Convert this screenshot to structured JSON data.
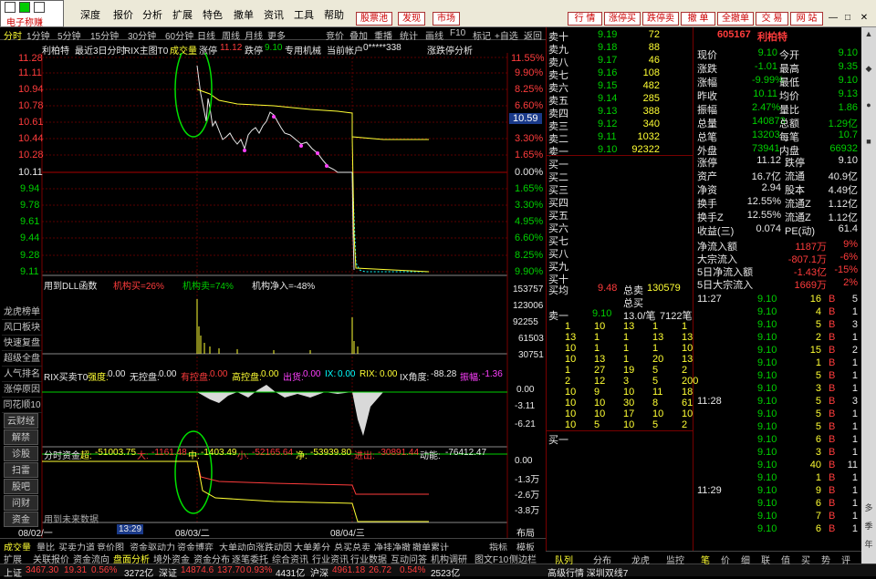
{
  "menu": {
    "logo_label": "电子称赚",
    "items": [
      "",
      "深度",
      "报价",
      "分析",
      "扩展",
      "特色",
      "撒单",
      "资讯",
      "工具",
      "帮助"
    ],
    "pills": [
      "股票池",
      "发现",
      "市场"
    ],
    "right_tabs": [
      "行 情",
      "涨停买",
      "跌停卖",
      "撤 单",
      "全撤单",
      "交 易",
      "网 站"
    ]
  },
  "toolbar": {
    "items": [
      "分时",
      "1分钟",
      "5分钟",
      "15分钟",
      "30分钟",
      "60分钟",
      "日线",
      "周线",
      "月线",
      "更多",
      "竞价",
      "叠加",
      "重播",
      "统计",
      "画线",
      "F10",
      "标记",
      "+自选",
      "返回"
    ]
  },
  "chart_header": {
    "name": "利柏特",
    "title": "最近3日分时",
    "indicator": "RIX主图T0",
    "mode": "成交量",
    "zt_label": "涨停",
    "zt": "11.12",
    "dt_label": "跌停",
    "dt": "9.10",
    "org": "专用机械",
    "account": "当前帐户",
    "account_id": "0*****338",
    "right": "涨跌停分析"
  },
  "price_axis": {
    "left": [
      "11.28",
      "11.11",
      "10.94",
      "10.78",
      "10.61",
      "10.44",
      "10.28",
      "10.11",
      "9.94",
      "9.78",
      "9.61",
      "9.44",
      "9.28",
      "9.11"
    ],
    "right": [
      "11.55%",
      "9.90%",
      "8.25%",
      "6.60%",
      "4.95%",
      "3.30%",
      "1.65%",
      "0.00%",
      "1.65%",
      "3.30%",
      "4.95%",
      "6.60%",
      "8.25%",
      "9.90%"
    ],
    "current": "10.59"
  },
  "vol_panel": {
    "title": "用到DLL函数",
    "buy": "机构买=26%",
    "sell": "机构卖=74%",
    "net": "机构净入=-48%",
    "axis": [
      "153757",
      "123006",
      "92255",
      "61503",
      "30751"
    ]
  },
  "rix_panel": {
    "title": "RIX买卖T0",
    "items": [
      {
        "k": "强度:",
        "v": "0.00"
      },
      {
        "k": "无控盘:",
        "v": "0.00"
      },
      {
        "k": "有控盘:",
        "v": "0.00"
      },
      {
        "k": "高控盘:",
        "v": "0.00"
      },
      {
        "k": "出货:",
        "v": "0.00"
      },
      {
        "k": "IX:",
        "v": "0.00"
      },
      {
        "k": "RIX:",
        "v": "0.00"
      },
      {
        "k": "IX角度:",
        "v": "-88.28"
      },
      {
        "k": "振幅:",
        "v": "-1.36"
      }
    ],
    "axis": [
      "0.00",
      "-3.11",
      "-6.21"
    ]
  },
  "fund_panel": {
    "title": "分时资金",
    "items": [
      {
        "k": "超:",
        "v": "-51003.75"
      },
      {
        "k": "大:",
        "v": "-1161.48"
      },
      {
        "k": "中:",
        "v": "-1403.49"
      },
      {
        "k": "小:",
        "v": "-52165.64"
      },
      {
        "k": "净:",
        "v": "-53939.80"
      },
      {
        "k": "进出:",
        "v": "-30891.44"
      },
      {
        "k": "动能:",
        "v": "-76412.47"
      }
    ],
    "axis": [
      "0.00",
      "-1.3万",
      "-2.6万",
      "-3.8万"
    ],
    "note": "用到未来数据"
  },
  "xaxis": {
    "labels": [
      "08/02/一",
      "13:29",
      "08/03/二",
      "08/04/三"
    ],
    "layout": "布局"
  },
  "side_menu": [
    "龙虎榜单",
    "风口板块",
    "快速复盘",
    "超级全盘",
    "人气排名",
    "涨停原因",
    "同花顺10",
    "云财经",
    "解禁",
    "诊股",
    "扫雷",
    "股吧",
    "问财",
    "资金"
  ],
  "bottom_tabs": [
    "成交量",
    "量比",
    "买卖力道",
    "竞价图",
    "资金驱动力",
    "资金博弈",
    "大单动向",
    "涨跌动因",
    "大单差分",
    "总买总卖",
    "净挂净撤",
    "撤单累计",
    "指标",
    "模板"
  ],
  "bottom_tabs2": [
    "扩展",
    "关联报价",
    "资金流向",
    "盘面分析",
    "境外资金",
    "资金分布",
    "逐笔委托",
    "综合资讯",
    "行业资讯",
    "行业数据",
    "互动问答",
    "机构调研",
    "图文F10",
    "侧边栏"
  ],
  "status": {
    "items": [
      {
        "n": "上证",
        "v": "3467.30",
        "c": "19.31",
        "p": "0.56%",
        "a": "3272亿"
      },
      {
        "n": "深证",
        "v": "14874.6",
        "c": "137.70",
        "p": "0.93%",
        "a": "4431亿"
      },
      {
        "n": "沪深",
        "v": "4961.18",
        "c": "26.72",
        "p": "0.54%",
        "a": "2523亿"
      }
    ],
    "ticker": "高级行情 深圳双线7"
  },
  "orderbook": {
    "sells": [
      {
        "l": "卖十",
        "p": "9.19",
        "v": "72"
      },
      {
        "l": "卖九",
        "p": "9.18",
        "v": "88"
      },
      {
        "l": "卖八",
        "p": "9.17",
        "v": "46"
      },
      {
        "l": "卖七",
        "p": "9.16",
        "v": "108"
      },
      {
        "l": "卖六",
        "p": "9.15",
        "v": "482"
      },
      {
        "l": "卖五",
        "p": "9.14",
        "v": "285"
      },
      {
        "l": "卖四",
        "p": "9.13",
        "v": "388"
      },
      {
        "l": "卖三",
        "p": "9.12",
        "v": "340"
      },
      {
        "l": "卖二",
        "p": "9.11",
        "v": "1032"
      },
      {
        "l": "卖一",
        "p": "9.10",
        "v": "92322"
      }
    ],
    "buys": [
      "买一",
      "买二",
      "买三",
      "买四",
      "买五",
      "买六",
      "买七",
      "买八",
      "买九",
      "买十"
    ],
    "avg_buy_l": "买均",
    "avg_buy": "9.48",
    "total_sell_l": "总卖",
    "total_sell": "130579",
    "total_buy_l": "总买",
    "sell1_l": "卖一",
    "sell1_p": "9.10",
    "sell1_per": "13.0/笔",
    "sell1_cnt": "7122笔",
    "queue": [
      [
        "1",
        "10",
        "13",
        "1",
        "1"
      ],
      [
        "13",
        "1",
        "1",
        "13",
        "13"
      ],
      [
        "10",
        "1",
        "1",
        "1",
        "10"
      ],
      [
        "10",
        "13",
        "1",
        "20",
        "13"
      ],
      [
        "1",
        "27",
        "19",
        "5",
        "2"
      ],
      [
        "2",
        "12",
        "3",
        "5",
        "200"
      ],
      [
        "10",
        "9",
        "10",
        "11",
        "18"
      ],
      [
        "10",
        "10",
        "30",
        "8",
        "61"
      ],
      [
        "10",
        "10",
        "17",
        "10",
        "10"
      ],
      [
        "10",
        "5",
        "10",
        "5",
        "2"
      ]
    ],
    "buy1_l": "买一"
  },
  "info": {
    "code": "605167",
    "name": "利柏特",
    "rows": [
      {
        "a": "现价",
        "b": "9.10",
        "c": "今开",
        "d": "9.10"
      },
      {
        "a": "涨跌",
        "b": "-1.01",
        "c": "最高",
        "d": "9.35"
      },
      {
        "a": "涨幅",
        "b": "-9.99%",
        "c": "最低",
        "d": "9.10"
      },
      {
        "a": "昨收",
        "b": "10.11",
        "c": "均价",
        "d": "9.13"
      },
      {
        "a": "振幅",
        "b": "2.47%",
        "c": "量比",
        "d": "1.86"
      },
      {
        "a": "总量",
        "b": "140873",
        "c": "总额",
        "d": "1.29亿"
      },
      {
        "a": "总笔",
        "b": "13203",
        "c": "每笔",
        "d": "10.7"
      },
      {
        "a": "外盘",
        "b": "73941",
        "c": "内盘",
        "d": "66932"
      }
    ],
    "rows2": [
      {
        "a": "涨停",
        "b": "11.12",
        "c": "跌停",
        "d": "9.10"
      },
      {
        "a": "资产",
        "b": "16.7亿",
        "c": "流通",
        "d": "40.9亿"
      },
      {
        "a": "净资",
        "b": "2.94",
        "c": "股本",
        "d": "4.49亿"
      },
      {
        "a": "换手",
        "b": "12.55%",
        "c": "流通Z",
        "d": "1.12亿"
      },
      {
        "a": "换手Z",
        "b": "12.55%",
        "c": "流通Z",
        "d": "1.12亿"
      },
      {
        "a": "收益(三)",
        "b": "0.074",
        "c": "PE(动)",
        "d": "61.4"
      }
    ],
    "flows": [
      {
        "a": "净流入额",
        "b": "1187万",
        "c": "9%"
      },
      {
        "a": "大宗流入",
        "b": "-807.1万",
        "c": "-6%"
      },
      {
        "a": "5日净流入额",
        "b": "-1.43亿",
        "c": "-15%"
      },
      {
        "a": "5日大宗流入",
        "b": "1669万",
        "c": "2%"
      }
    ],
    "ticks": [
      {
        "t": "11:27",
        "p": "9.10",
        "v": "16",
        "s": "B",
        "n": "5"
      },
      {
        "t": "",
        "p": "9.10",
        "v": "4",
        "s": "B",
        "n": "1"
      },
      {
        "t": "",
        "p": "9.10",
        "v": "5",
        "s": "B",
        "n": "3"
      },
      {
        "t": "",
        "p": "9.10",
        "v": "2",
        "s": "B",
        "n": "1"
      },
      {
        "t": "",
        "p": "9.10",
        "v": "15",
        "s": "B",
        "n": "2"
      },
      {
        "t": "",
        "p": "9.10",
        "v": "1",
        "s": "B",
        "n": "1"
      },
      {
        "t": "",
        "p": "9.10",
        "v": "5",
        "s": "B",
        "n": "1"
      },
      {
        "t": "",
        "p": "9.10",
        "v": "3",
        "s": "B",
        "n": "1"
      },
      {
        "t": "11:28",
        "p": "9.10",
        "v": "5",
        "s": "B",
        "n": "3"
      },
      {
        "t": "",
        "p": "9.10",
        "v": "5",
        "s": "B",
        "n": "1"
      },
      {
        "t": "",
        "p": "9.10",
        "v": "5",
        "s": "B",
        "n": "1"
      },
      {
        "t": "",
        "p": "9.10",
        "v": "6",
        "s": "B",
        "n": "1"
      },
      {
        "t": "",
        "p": "9.10",
        "v": "3",
        "s": "B",
        "n": "1"
      },
      {
        "t": "",
        "p": "9.10",
        "v": "40",
        "s": "B",
        "n": "11"
      },
      {
        "t": "",
        "p": "9.10",
        "v": "1",
        "s": "B",
        "n": "1"
      },
      {
        "t": "11:29",
        "p": "9.10",
        "v": "9",
        "s": "B",
        "n": "1"
      },
      {
        "t": "",
        "p": "9.10",
        "v": "6",
        "s": "B",
        "n": "1"
      },
      {
        "t": "",
        "p": "9.10",
        "v": "7",
        "s": "B",
        "n": "1"
      },
      {
        "t": "",
        "p": "9.10",
        "v": "6",
        "s": "B",
        "n": "1"
      }
    ]
  },
  "right_tabs": [
    "队列",
    "分布",
    "龙虎",
    "监控"
  ],
  "tick_tabs": [
    "笔",
    "价",
    "细",
    "联",
    "值",
    "买",
    "势",
    "评"
  ],
  "scroll_labels": [
    "多",
    "季",
    "年"
  ]
}
